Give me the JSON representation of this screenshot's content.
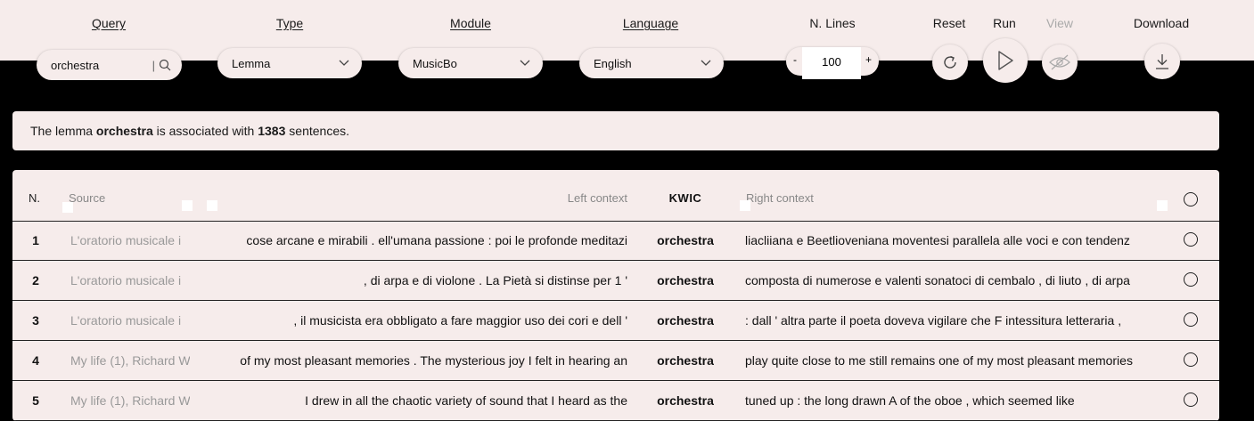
{
  "toolbar": {
    "query_label": "Query",
    "type_label": "Type",
    "module_label": "Module",
    "language_label": "Language",
    "nlines_label": "N. Lines",
    "reset_label": "Reset",
    "run_label": "Run",
    "view_label": "View",
    "download_label": "Download",
    "query_value": "orchestra",
    "type_value": "Lemma",
    "module_value": "MusicBo",
    "language_value": "English",
    "nlines_minus": "-",
    "nlines_value": "100",
    "nlines_plus": "+"
  },
  "summary": {
    "prefix": "The lemma",
    "lemma": "orchestra",
    "middle": "is associated with",
    "count": "1383",
    "suffix": "sentences."
  },
  "table": {
    "headers": {
      "n": "N.",
      "source": "Source",
      "left": "Left context",
      "kwic": "KWIC",
      "right": "Right context"
    },
    "rows": [
      {
        "n": "1",
        "source": "L'oratorio musicale i",
        "left": "cose arcane e mirabili . ell'umana passione : poi le profonde meditazi",
        "kwic": "orchestra",
        "right": "liacliiana e Beetlioveniana moventesi parallela alle voci e con tendenz"
      },
      {
        "n": "2",
        "source": "L'oratorio musicale i",
        "left": ", di arpa e di violone . La Pietà si distinse per 1 '",
        "kwic": "orchestra",
        "right": "composta di numerose e valenti sonatoci di cembalo , di liuto , di arpa"
      },
      {
        "n": "3",
        "source": "L'oratorio musicale i",
        "left": ", il musicista era obbligato a fare maggior uso dei cori e dell '",
        "kwic": "orchestra",
        "right": ": dall ' altra parte il poeta doveva vigilare che F intessitura letteraria ,"
      },
      {
        "n": "4",
        "source": "My life (1), Richard W",
        "left": "of my most pleasant memories . The mysterious joy I felt in hearing an",
        "kwic": "orchestra",
        "right": "play quite close to me still remains one of my most pleasant memories"
      },
      {
        "n": "5",
        "source": "My life (1), Richard W",
        "left": "I drew in all the chaotic variety of sound that I heard as the",
        "kwic": "orchestra",
        "right": "tuned up : the long drawn A of the oboe , which seemed like"
      }
    ]
  }
}
